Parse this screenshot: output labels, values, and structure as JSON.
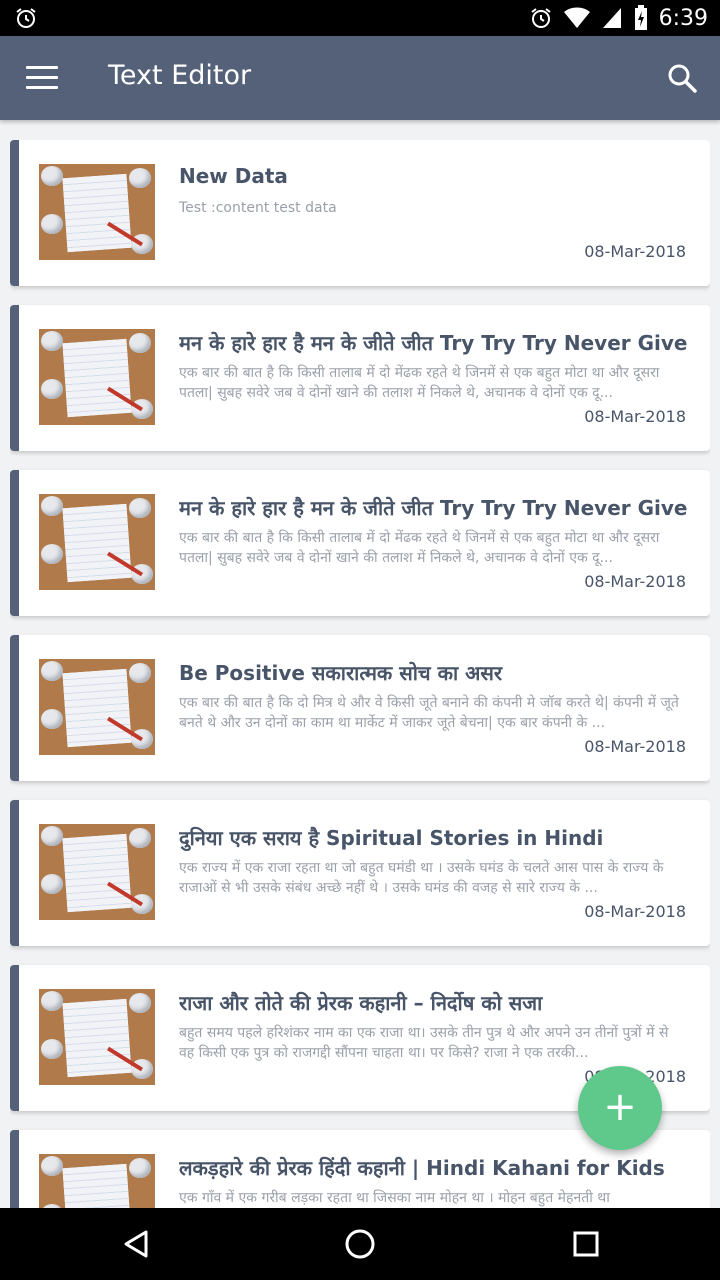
{
  "status_bar": {
    "time": "6:39"
  },
  "app_bar": {
    "title": "Text Editor",
    "menu_icon": "hamburger-menu-icon",
    "search_icon": "search-icon"
  },
  "notes": [
    {
      "title": "New Data",
      "content": "Test :content test data",
      "date": "08-Mar-2018"
    },
    {
      "title": "मन के हारे हार है मन के जीते जीत Try Try Try Never Give Up",
      "content": "एक बार की बात है कि किसी तालाब में दो मेंढक रहते थे जिनमें से एक बहुत मोटा था और दूसरा पतला| सुबह सवेरे जब वे दोनों खाने की तलाश में निकले थे, अचानक वे दोनों एक दू...",
      "date": "08-Mar-2018"
    },
    {
      "title": "मन के हारे हार है मन के जीते जीत Try Try Try Never Give Up",
      "content": "एक बार की बात है कि किसी तालाब में दो मेंढक रहते थे जिनमें से एक बहुत मोटा था और दूसरा पतला| सुबह सवेरे जब वे दोनों खाने की तलाश में निकले थे, अचानक वे दोनों एक दू...",
      "date": "08-Mar-2018"
    },
    {
      "title": "Be Positive सकारात्मक सोच का असर",
      "content": "एक बार की बात है कि दो मित्र थे और वे किसी जूते बनाने की कंपनी मे जॉब करते थे| कंपनी में जूते बनते थे और उन दोनों का काम था मार्केट में जाकर जूते बेचना| एक बार कंपनी के ...",
      "date": "08-Mar-2018"
    },
    {
      "title": "दुनिया एक सराय है Spiritual Stories in Hindi",
      "content": "एक राज्य में एक राजा रहता था जो बहुत घमंडी था । उसके घमंड के चलते आस पास के राज्य के राजाओं से भी उसके संबंध अच्छे नहीं थे । उसके घमंड की वजह से सारे राज्य के ...",
      "date": "08-Mar-2018"
    },
    {
      "title": "राजा और तोते की प्रेरक कहानी – निर्दोष को सजा",
      "content": "बहुत समय पहले हरिशंकर नाम का एक राजा था। उसके तीन पुत्र थे और अपने उन तीनों पुत्रों में से वह किसी एक पुत्र को राजगद्दी सौंपना चाहता था। पर किसे? राजा ने एक तरकी...",
      "date": "08-Mar-2018"
    },
    {
      "title": "लकड़हारे की प्रेरक हिंदी कहानी | Hindi Kahani for Kids",
      "content": "एक गाँव में एक गरीब लड़का रहता था जिसका नाम मोहन था । मोहन बहुत मेहनती था",
      "date": ""
    }
  ],
  "fab": {
    "label": "+",
    "icon": "add-icon"
  },
  "nav_bar": {
    "back_icon": "back-triangle-icon",
    "home_icon": "home-circle-icon",
    "recents_icon": "recents-square-icon"
  }
}
